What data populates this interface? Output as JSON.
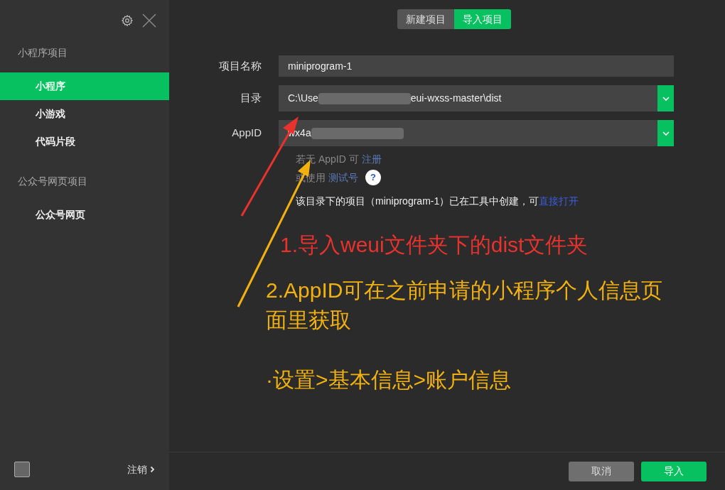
{
  "sidebar": {
    "groups": [
      {
        "title": "小程序项目",
        "items": [
          {
            "label": "小程序",
            "selected": true
          },
          {
            "label": "小游戏",
            "selected": false
          },
          {
            "label": "代码片段",
            "selected": false
          }
        ]
      },
      {
        "title": "公众号网页项目",
        "items": [
          {
            "label": "公众号网页",
            "selected": false
          }
        ]
      }
    ],
    "logout": "注销"
  },
  "tabs": [
    {
      "label": "新建项目",
      "selected": false
    },
    {
      "label": "导入项目",
      "selected": true
    }
  ],
  "form": {
    "fields": [
      {
        "label": "项目名称",
        "kind": "text",
        "value_start": "miniprogram-1",
        "blurred": false
      },
      {
        "label": "目录",
        "kind": "select",
        "value_start": "C:\\Use",
        "blurred": true,
        "value_end": "eui-wxss-master\\dist"
      },
      {
        "label": "AppID",
        "kind": "select",
        "value_start": "wx4a",
        "blurred": true
      }
    ],
    "hint_1": "若无 AppID 可",
    "hint_1_link": "注册",
    "hint_2": "或使用",
    "hint_2_link": "测试号",
    "help": "?",
    "notice": "该目录下的项目（miniprogram-1）已在工具中创建，可",
    "notice_link": "直接打开"
  },
  "annotations": [
    {
      "color": "#e8322d",
      "lines": [
        "1.导入weui文件夹下的dist文件夹"
      ]
    },
    {
      "color": "#f2b10f",
      "lines": [
        "2.AppID可在之前申请的小程序个人信息页",
        "面里获取"
      ]
    },
    {
      "color": "#f2b10f",
      "lines": [
        "·设置>基本信息>账户信息"
      ]
    }
  ],
  "buttons": {
    "cancel": "取消",
    "confirm": "导入"
  }
}
